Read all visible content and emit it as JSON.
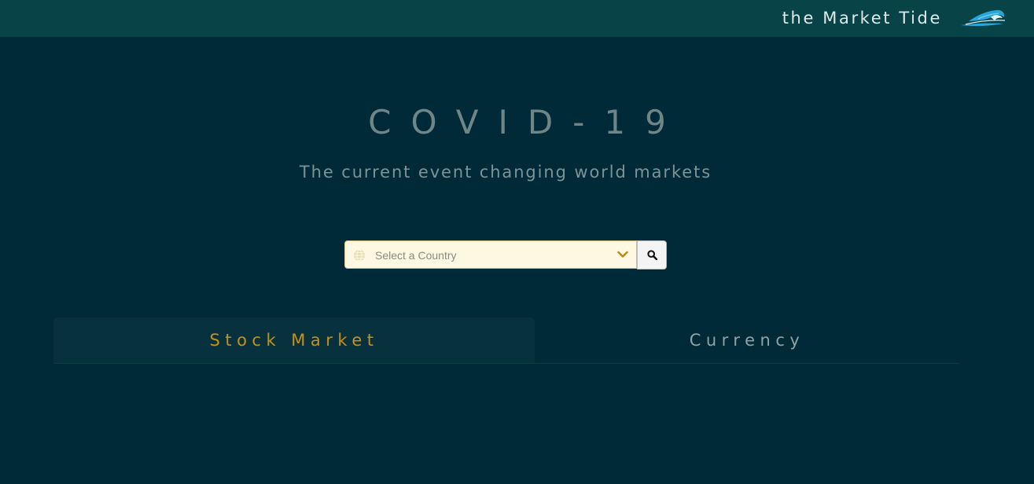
{
  "header": {
    "brand_title": "the Market Tide",
    "logo_icon": "wave-logo-icon"
  },
  "hero": {
    "title": "COVID-19",
    "subtitle": "The current event changing world markets"
  },
  "country_select": {
    "placeholder": "Select a Country",
    "leading_icon": "globe-icon",
    "trailing_icon": "chevron-down-icon",
    "search_icon": "search-icon"
  },
  "tabs": [
    {
      "label": "Stock Market",
      "active": true
    },
    {
      "label": "Currency",
      "active": false
    }
  ],
  "colors": {
    "background": "#002a37",
    "header_background": "#074347",
    "accent_gold": "#c78f1d",
    "select_background": "#fef7e1",
    "logo_blue": "#2aa7d9"
  }
}
